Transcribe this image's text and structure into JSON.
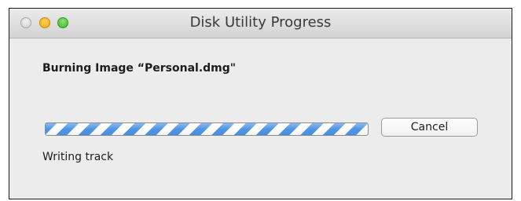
{
  "window": {
    "title": "Disk Utility Progress"
  },
  "task": {
    "heading": "Burning Image “Personal.dmg\"",
    "status": "Writing track",
    "progress_state": "indeterminate"
  },
  "buttons": {
    "cancel_label": "Cancel"
  },
  "colors": {
    "progress_stripe": "#4f95e6",
    "minimize": "#f0a600",
    "zoom": "#3fb427"
  }
}
